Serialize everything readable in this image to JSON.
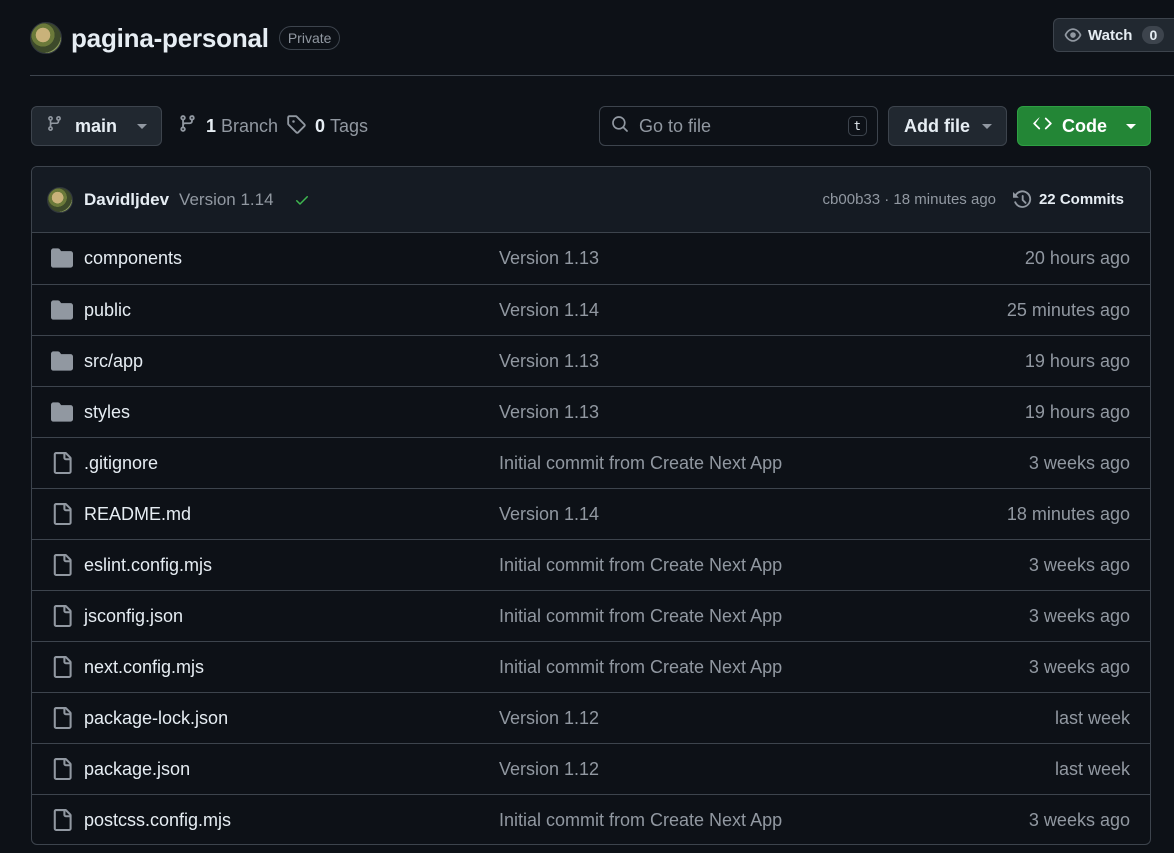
{
  "repo": {
    "name": "pagina-personal",
    "visibility": "Private",
    "watch_label": "Watch",
    "watch_count": "0"
  },
  "toolbar": {
    "branch": "main",
    "branch_count": "1",
    "branch_label": "Branch",
    "tag_count": "0",
    "tag_label": "Tags",
    "search_placeholder": "Go to file",
    "search_shortcut": "t",
    "add_file_label": "Add file",
    "code_label": "Code",
    "code_color": "#238636"
  },
  "latest_commit": {
    "author": "Davidljdev",
    "message": "Version 1.14",
    "status": "success",
    "status_color": "#3fb950",
    "info": "cb00b33 · 18 minutes ago",
    "commits_label": "22 Commits"
  },
  "files": [
    {
      "type": "folder",
      "icon": "folder-icon",
      "name": "components",
      "message": "Version 1.13",
      "time": "20 hours ago"
    },
    {
      "type": "folder",
      "icon": "folder-icon",
      "name": "public",
      "message": "Version 1.14",
      "time": "25 minutes ago"
    },
    {
      "type": "folder",
      "icon": "folder-icon",
      "name": "src/app",
      "message": "Version 1.13",
      "time": "19 hours ago"
    },
    {
      "type": "folder",
      "icon": "folder-icon",
      "name": "styles",
      "message": "Version 1.13",
      "time": "19 hours ago"
    },
    {
      "type": "file",
      "icon": "file-icon",
      "name": ".gitignore",
      "message": "Initial commit from Create Next App",
      "time": "3 weeks ago"
    },
    {
      "type": "file",
      "icon": "file-icon",
      "name": "README.md",
      "message": "Version 1.14",
      "time": "18 minutes ago"
    },
    {
      "type": "file",
      "icon": "file-icon",
      "name": "eslint.config.mjs",
      "message": "Initial commit from Create Next App",
      "time": "3 weeks ago"
    },
    {
      "type": "file",
      "icon": "file-icon",
      "name": "jsconfig.json",
      "message": "Initial commit from Create Next App",
      "time": "3 weeks ago"
    },
    {
      "type": "file",
      "icon": "file-icon",
      "name": "next.config.mjs",
      "message": "Initial commit from Create Next App",
      "time": "3 weeks ago"
    },
    {
      "type": "file",
      "icon": "file-icon",
      "name": "package-lock.json",
      "message": "Version 1.12",
      "time": "last week"
    },
    {
      "type": "file",
      "icon": "file-icon",
      "name": "package.json",
      "message": "Version 1.12",
      "time": "last week"
    },
    {
      "type": "file",
      "icon": "file-icon",
      "name": "postcss.config.mjs",
      "message": "Initial commit from Create Next App",
      "time": "3 weeks ago"
    }
  ]
}
